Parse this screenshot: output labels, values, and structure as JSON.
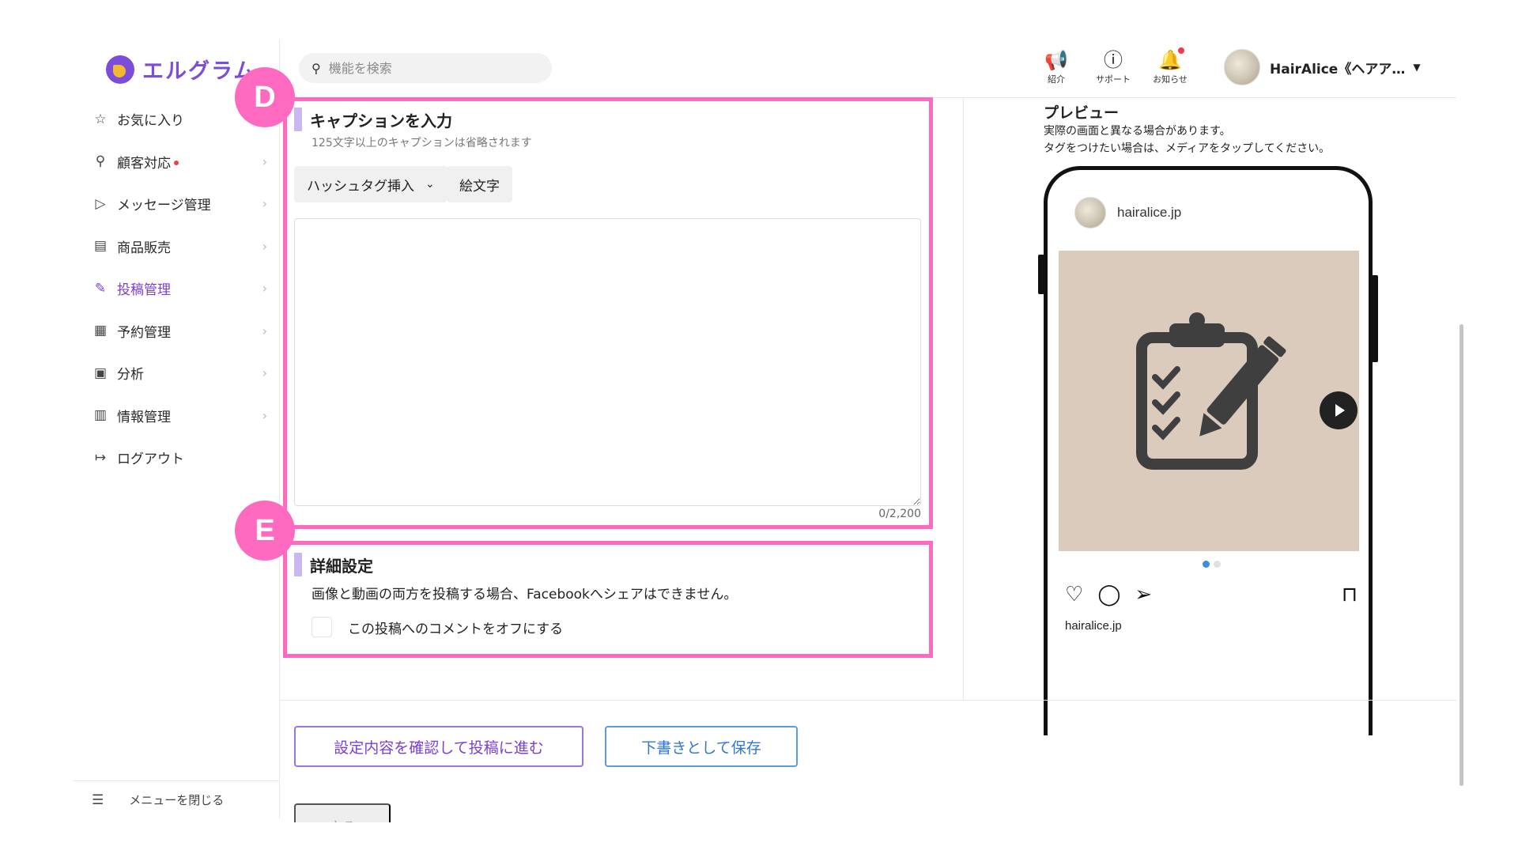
{
  "sidebar": {
    "logo_text": "エルグラム",
    "items": [
      {
        "label": "お気に入り",
        "icon": "star-icon",
        "glyph": "☆",
        "chevron": false,
        "dot": false,
        "active": false
      },
      {
        "label": "顧客対応",
        "icon": "person-icon",
        "glyph": "⚲",
        "chevron": true,
        "dot": true,
        "active": false
      },
      {
        "label": "メッセージ管理",
        "icon": "send-icon",
        "glyph": "▷",
        "chevron": true,
        "dot": false,
        "active": false
      },
      {
        "label": "商品販売",
        "icon": "store-icon",
        "glyph": "▤",
        "chevron": true,
        "dot": false,
        "active": false
      },
      {
        "label": "投稿管理",
        "icon": "edit-icon",
        "glyph": "✎",
        "chevron": true,
        "dot": false,
        "active": true
      },
      {
        "label": "予約管理",
        "icon": "calendar-icon",
        "glyph": "▦",
        "chevron": true,
        "dot": false,
        "active": false
      },
      {
        "label": "分析",
        "icon": "report-icon",
        "glyph": "▣",
        "chevron": true,
        "dot": false,
        "active": false
      },
      {
        "label": "情報管理",
        "icon": "bar-chart-icon",
        "glyph": "▥",
        "chevron": true,
        "dot": false,
        "active": false
      },
      {
        "label": "ログアウト",
        "icon": "logout-icon",
        "glyph": "↦",
        "chevron": false,
        "dot": false,
        "active": false
      }
    ],
    "chevron_glyph": "›",
    "close_menu_label": "メニューを閉じる"
  },
  "header": {
    "search_placeholder": "機能を検索",
    "icons": [
      {
        "label": "紹介",
        "icon": "megaphone-icon",
        "glyph": "📢"
      },
      {
        "label": "サポート",
        "icon": "help-icon",
        "glyph": "ⓘ"
      },
      {
        "label": "お知らせ",
        "icon": "bell-icon",
        "glyph": "🔔"
      }
    ],
    "user_name": "HairAlice《ヘアア…"
  },
  "caption": {
    "badge": "D",
    "title": "キャプションを入力",
    "hint": "125文字以上のキャプションは省略されます",
    "hashtag_button": "ハッシュタグ挿入",
    "emoji_button": "絵文字",
    "value": "",
    "counter": "0/2,200"
  },
  "details": {
    "badge": "E",
    "title": "詳細設定",
    "description": "画像と動画の両方を投稿する場合、Facebookへシェアはできません。",
    "comment_off_label": "この投稿へのコメントをオフにする",
    "comment_off_checked": false
  },
  "preview": {
    "title": "プレビュー",
    "note_line1": "実際の画面と異なる場合があります。",
    "note_line2": "タグをつけたい場合は、メディアをタップしてください。",
    "handle": "hairalice.jp",
    "caption_handle": "hairalice.jp",
    "media_icon": "clipboard-edit-icon",
    "carousel_index": 1,
    "carousel_count": 2
  },
  "actions": {
    "confirm_label": "設定内容を確認して投稿に進む",
    "draft_label": "下書きとして保存",
    "back_label": "戻る"
  },
  "colors": {
    "accent_purple": "#7b3fd6",
    "highlight_pink": "#ff6ac1",
    "blue": "#2f77d4",
    "media_bg": "#dacbbd"
  }
}
